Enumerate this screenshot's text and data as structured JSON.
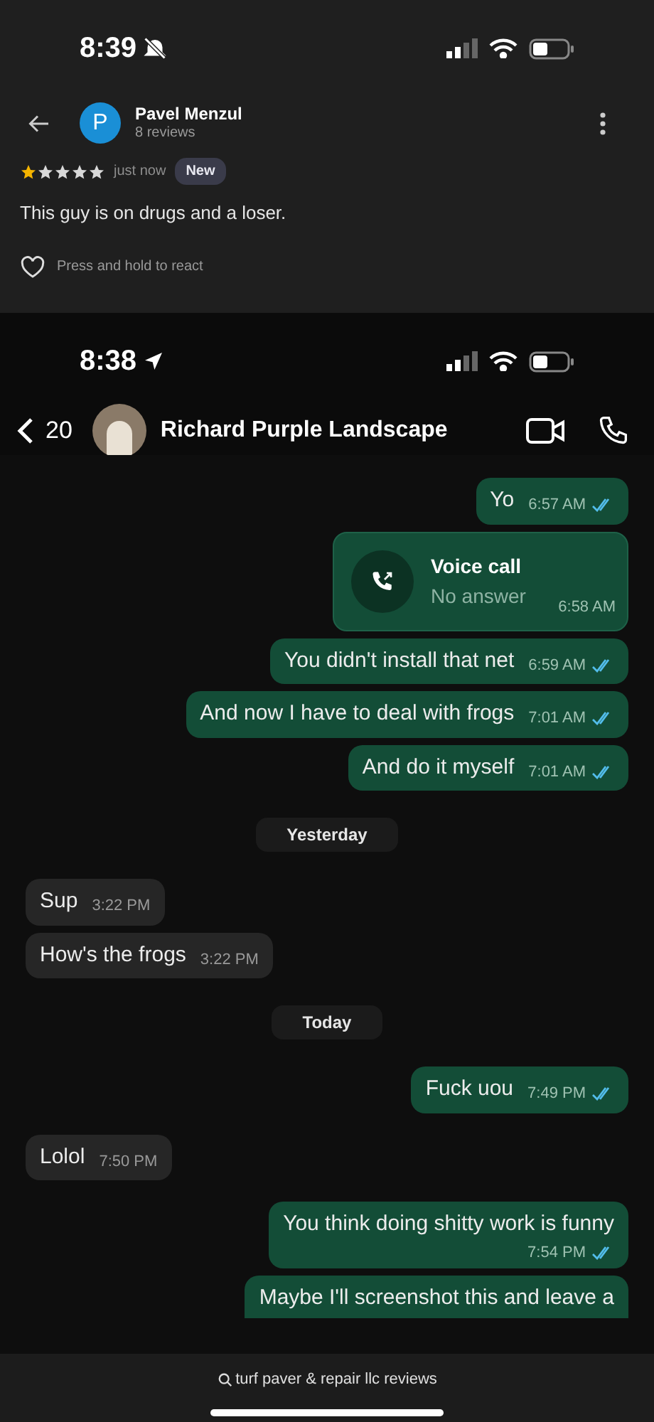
{
  "review_screen": {
    "status_bar": {
      "time": "8:39",
      "silent": true
    },
    "reviewer": {
      "initial": "P",
      "name": "Pavel Menzul",
      "subtitle": "8 reviews"
    },
    "review": {
      "stars": 1,
      "time": "just now",
      "badge": "New",
      "text": "This guy is on drugs and a loser.",
      "react_hint": "Press and hold to react"
    }
  },
  "chat_screen": {
    "status_bar": {
      "time": "8:38",
      "location": true
    },
    "header": {
      "back_count": "20",
      "contact": "Richard Purple Landscape"
    },
    "messages": [
      {
        "kind": "text",
        "outgoing": true,
        "text": "Yo",
        "time": "6:57 AM",
        "read": true
      },
      {
        "kind": "call",
        "outgoing": true,
        "title": "Voice call",
        "subtitle": "No answer",
        "time": "6:58 AM"
      },
      {
        "kind": "text",
        "outgoing": true,
        "text": "You didn't install that net",
        "time": "6:59 AM",
        "read": true
      },
      {
        "kind": "text",
        "outgoing": true,
        "text": "And now I have to deal with frogs",
        "time": "7:01 AM",
        "read": true
      },
      {
        "kind": "text",
        "outgoing": true,
        "text": "And do it myself",
        "time": "7:01 AM",
        "read": true
      },
      {
        "kind": "date",
        "text": "Yesterday"
      },
      {
        "kind": "text",
        "outgoing": false,
        "text": "Sup",
        "time": "3:22 PM"
      },
      {
        "kind": "text",
        "outgoing": false,
        "text": "How's the frogs",
        "time": "3:22 PM"
      },
      {
        "kind": "date",
        "text": "Today"
      },
      {
        "kind": "text",
        "outgoing": true,
        "text": "Fuck uou",
        "time": "7:49 PM",
        "read": true
      },
      {
        "kind": "text",
        "outgoing": false,
        "text": "Lolol",
        "time": "7:50 PM"
      },
      {
        "kind": "long",
        "outgoing": true,
        "text": "You think doing shitty work is funny",
        "time": "7:54 PM",
        "read": true
      },
      {
        "kind": "partial",
        "outgoing": true,
        "text": "Maybe I'll screenshot this and leave a"
      }
    ]
  },
  "bottom_bar": {
    "search_text": "turf paver & repair llc reviews"
  }
}
